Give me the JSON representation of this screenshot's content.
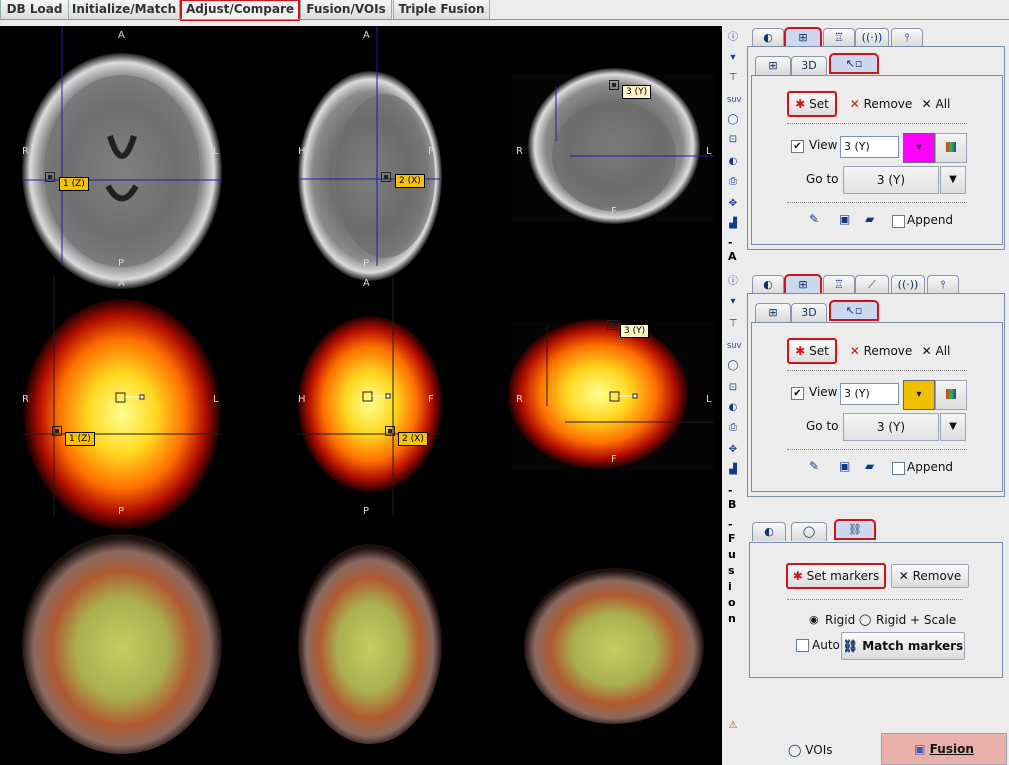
{
  "top_tabs": [
    "DB Load",
    "Initialize/Match",
    "Adjust/Compare",
    "Fusion/VOIs",
    "Triple Fusion"
  ],
  "orientation": {
    "anterior": "A",
    "posterior": "P",
    "right": "R",
    "left": "L",
    "head": "H",
    "foot": "F"
  },
  "markers": {
    "m1": "1 (Z)",
    "m2": "2 (X)",
    "m3": "3 (Y)"
  },
  "side_letters": {
    "a_dash": "-",
    "a": "A",
    "b_dash": "-",
    "b": "B",
    "fusion_dash": "-",
    "fusion": [
      "F",
      "u",
      "s",
      "i",
      "o",
      "n"
    ]
  },
  "panel_a": {
    "subtab_3d": "3D",
    "set_label": "Set",
    "remove_label": "Remove",
    "all_label": "All",
    "view_label": "View",
    "view_value": "3 (Y)",
    "goto_label": "Go to",
    "goto_value": "3 (Y)",
    "append_label": "Append",
    "color_swatch": "#ff00ff"
  },
  "panel_b": {
    "subtab_3d": "3D",
    "set_label": "Set",
    "remove_label": "Remove",
    "all_label": "All",
    "view_label": "View",
    "view_value": "3 (Y)",
    "goto_label": "Go to",
    "goto_value": "3 (Y)",
    "append_label": "Append",
    "color_swatch": "#f0c000"
  },
  "fusion_panel": {
    "set_markers_label": "Set markers",
    "remove_label": "Remove",
    "rigid_label": "Rigid",
    "rigid_scale_label": "Rigid + Scale",
    "auto_label": "Auto",
    "match_markers_label": "Match markers"
  },
  "bottom": {
    "vois_label": "VOIs",
    "fusion_label": "Fusion"
  },
  "colors": {
    "highlight": "#d0131a",
    "marker_fill": "#f4c20b",
    "fusion_button": "#e8b0a8"
  }
}
